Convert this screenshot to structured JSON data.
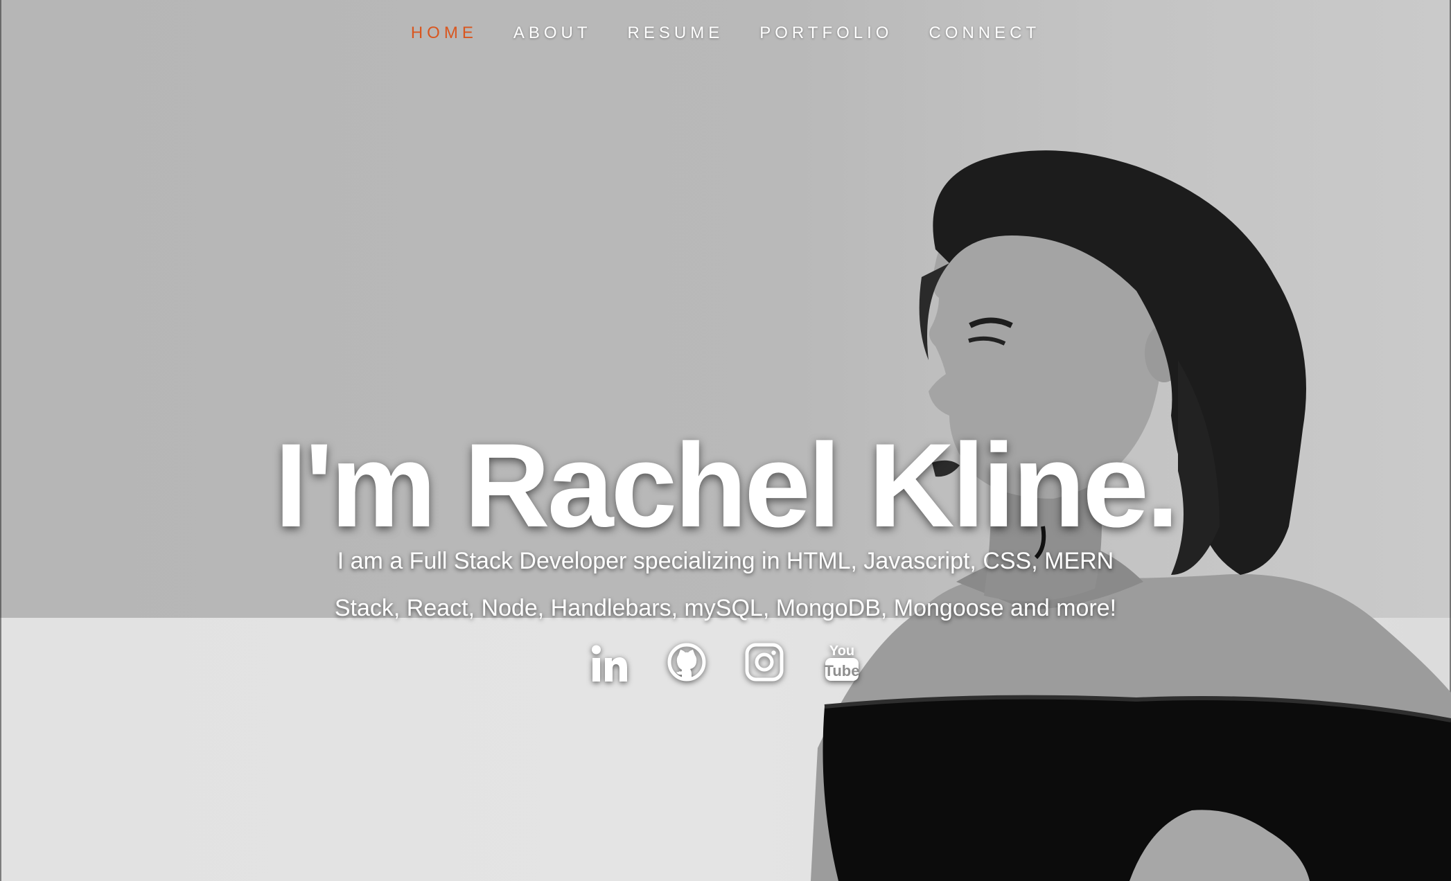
{
  "nav": {
    "items": [
      {
        "label": "HOME",
        "active": true
      },
      {
        "label": "ABOUT",
        "active": false
      },
      {
        "label": "RESUME",
        "active": false
      },
      {
        "label": "PORTFOLIO",
        "active": false
      },
      {
        "label": "CONNECT",
        "active": false
      }
    ],
    "active_color": "#d9561f"
  },
  "hero": {
    "headline": "I'm Rachel Kline.",
    "tagline": "I am a Full Stack Developer specializing in HTML, Javascript, CSS, MERN Stack, React, Node, Handlebars, mySQL, MongoDB, Mongoose and more!"
  },
  "social": {
    "icons": [
      "linkedin-icon",
      "github-icon",
      "instagram-icon",
      "youtube-icon"
    ],
    "youtube_text_top": "You",
    "youtube_text_bottom": "Tube",
    "linkedin_text": "in"
  }
}
